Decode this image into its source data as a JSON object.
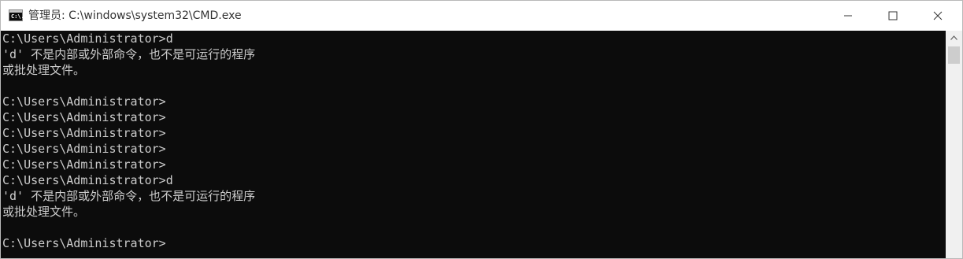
{
  "window": {
    "title": "管理员: C:\\windows\\system32\\CMD.exe",
    "app_icon_glyph": "C:\\.",
    "controls": {
      "minimize_icon": "minimize-icon",
      "maximize_icon": "maximize-icon",
      "close_icon": "close-icon"
    }
  },
  "console": {
    "lines": [
      "C:\\Users\\Administrator>d",
      "'d' 不是内部或外部命令，也不是可运行的程序",
      "或批处理文件。",
      "",
      "C:\\Users\\Administrator>",
      "C:\\Users\\Administrator>",
      "C:\\Users\\Administrator>",
      "C:\\Users\\Administrator>",
      "C:\\Users\\Administrator>",
      "C:\\Users\\Administrator>d",
      "'d' 不是内部或外部命令，也不是可运行的程序",
      "或批处理文件。",
      "",
      "C:\\Users\\Administrator>"
    ]
  },
  "colors": {
    "console_background": "#0c0c0c",
    "console_text": "#cccccc",
    "titlebar_background": "#ffffff"
  }
}
